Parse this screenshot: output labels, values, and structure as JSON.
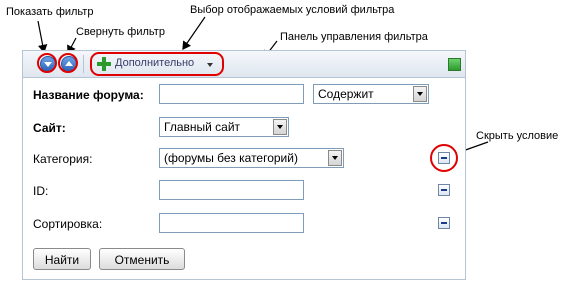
{
  "callouts": {
    "show_filter": "Показать фильтр",
    "collapse_filter": "Свернуть фильтр",
    "choose_conditions": "Выбор отображаемых условий фильтра",
    "control_panel": "Панель управления фильтра",
    "hide_condition": "Скрыть условие"
  },
  "toolbar": {
    "add_label": "Дополнительно"
  },
  "fields": [
    {
      "label": "Название форума:",
      "value": "",
      "select": "Содержит"
    },
    {
      "label": "Сайт:",
      "select": "Главный сайт"
    },
    {
      "label": "Категория:",
      "select": "(форумы без категорий)"
    },
    {
      "label": "ID:",
      "value": ""
    },
    {
      "label": "Сортировка:",
      "value": ""
    }
  ],
  "buttons": {
    "find": "Найти",
    "cancel": "Отменить"
  },
  "colors": {
    "annotation": "#e00000",
    "border": "#b7c4d4",
    "add_icon": "#2d9a2d"
  }
}
